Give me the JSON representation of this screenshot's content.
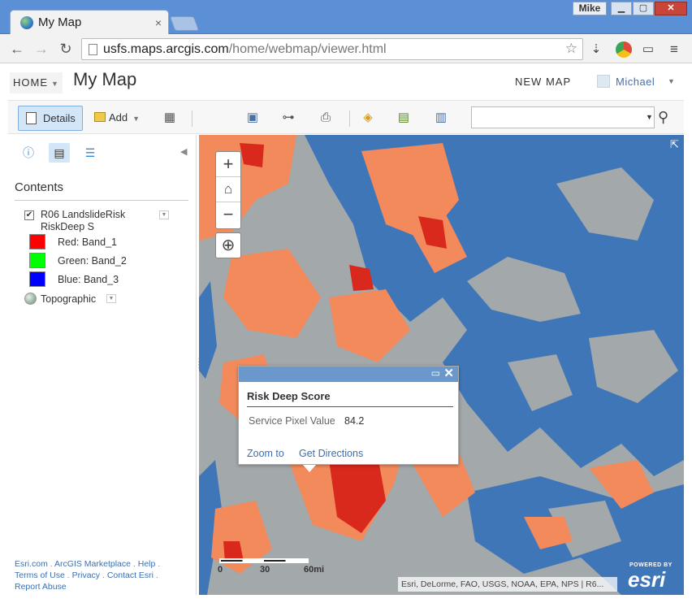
{
  "browser": {
    "tab_title": "My Map",
    "tab_close": "×",
    "user": "Mike",
    "url_host": "usfs.maps.arcgis.com",
    "url_path": "/home/webmap/viewer.html"
  },
  "header": {
    "home_label": "HOME",
    "map_title": "My Map",
    "new_map": "NEW MAP",
    "user_name": "Michael"
  },
  "mapbar": {
    "details_label": "Details",
    "add_label": "Add",
    "search_placeholder": ""
  },
  "panel": {
    "contents_heading": "Contents",
    "layer_name": "R06 LandslideRisk RiskDeep S",
    "bands": [
      {
        "label": "Red: Band_1",
        "color": "#ff0000"
      },
      {
        "label": "Green: Band_2",
        "color": "#00ff00"
      },
      {
        "label": "Blue: Band_3",
        "color": "#0000ff"
      }
    ],
    "basemap": "Topographic",
    "footer": {
      "esri": "Esri.com",
      "marketplace": "ArcGIS Marketplace",
      "help": "Help",
      "terms": "Terms of Use",
      "privacy": "Privacy",
      "contact": "Contact Esri",
      "abuse": "Report Abuse"
    }
  },
  "popup": {
    "title": "Risk Deep Score",
    "field": "Service Pixel Value",
    "value": "84.2",
    "zoom_to": "Zoom to",
    "directions": "Get Directions"
  },
  "map": {
    "scale_labels": [
      "0",
      "30",
      "60mi"
    ],
    "attribution": "Esri, DeLorme, FAO, USGS, NOAA, EPA, NPS | R6...",
    "powered_by": "POWERED BY",
    "logo": "esri",
    "colors": {
      "water": "#3f76b8",
      "land": "#a3a8ab",
      "risk_med": "#f28a5c",
      "risk_high": "#d9281c"
    }
  }
}
